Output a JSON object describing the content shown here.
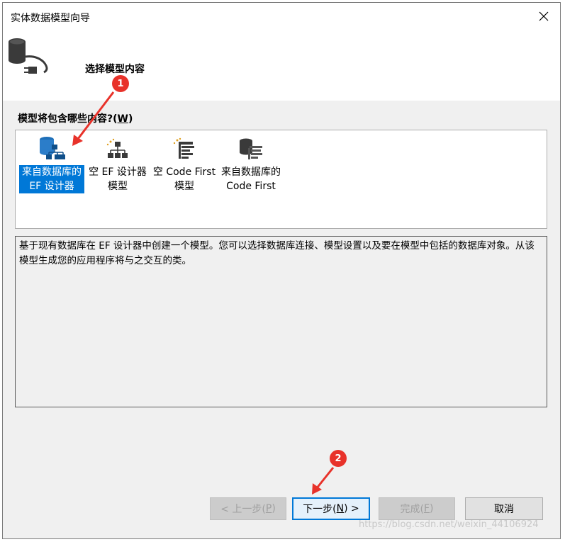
{
  "window": {
    "title": "实体数据模型向导"
  },
  "header": {
    "title": "选择模型内容"
  },
  "section": {
    "label_prefix": "模型将包含哪些内容?(",
    "label_key": "W",
    "label_suffix": ")"
  },
  "models": [
    {
      "line1": "来自数据库的",
      "line2": "EF 设计器",
      "selected": true,
      "icon": "database-diagram-icon"
    },
    {
      "line1": "空 EF 设计器",
      "line2": "模型",
      "selected": false,
      "icon": "empty-diagram-icon"
    },
    {
      "line1": "空 Code First",
      "line2": "模型",
      "selected": false,
      "icon": "empty-code-first-icon"
    },
    {
      "line1": "来自数据库的",
      "line2": "Code First",
      "selected": false,
      "icon": "database-code-first-icon"
    }
  ],
  "description": "基于现有数据库在 EF 设计器中创建一个模型。您可以选择数据库连接、模型设置以及要在模型中包括的数据库对象。从该模型生成您的应用程序将与之交互的类。",
  "buttons": {
    "prev": {
      "pre": "< 上一步(",
      "key": "P",
      "post": ")"
    },
    "next": {
      "pre": "下一步(",
      "key": "N",
      "post": ") >"
    },
    "finish": {
      "pre": "完成(",
      "key": "F",
      "post": ")"
    },
    "cancel": "取消"
  },
  "annotations": {
    "one": "1",
    "two": "2"
  },
  "watermark": "https://blog.csdn.net/weixin_44106924",
  "colors": {
    "accent": "#0078d7",
    "annotation": "#e8322a"
  }
}
